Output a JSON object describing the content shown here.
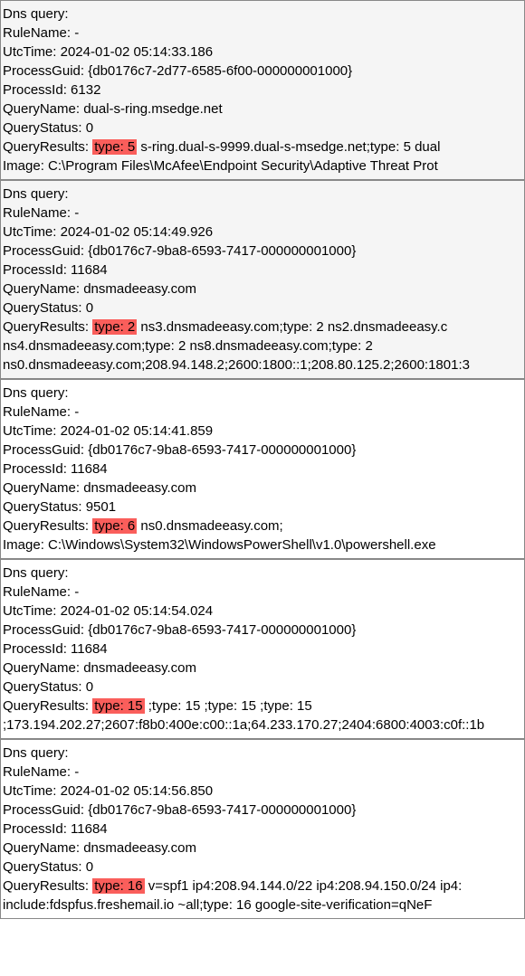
{
  "entries": [
    {
      "alt": true,
      "title": "Dns query:",
      "ruleNameLabel": "RuleName:",
      "ruleName": " -",
      "utcTimeLabel": "UtcTime:",
      "utcTime": " 2024-01-02 05:14:33.186",
      "processGuidLabel": "ProcessGuid:",
      "processGuid": " {db0176c7-2d77-6585-6f00-000000001000}",
      "processIdLabel": "ProcessId:",
      "processId": " 6132",
      "queryNameLabel": "QueryName:",
      "queryName": " dual-s-ring.msedge.net",
      "queryStatusLabel": "QueryStatus:",
      "queryStatus": " 0",
      "queryResultsLabel": "QueryResults:",
      "highlight": "type:  5",
      "queryResultsRest": " s-ring.dual-s-9999.dual-s-msedge.net;type:  5 dual",
      "imageLabel": "Image:",
      "image": " C:\\Program Files\\McAfee\\Endpoint Security\\Adaptive Threat Prot",
      "extraLines": []
    },
    {
      "alt": true,
      "title": "Dns query:",
      "ruleNameLabel": "RuleName:",
      "ruleName": " -",
      "utcTimeLabel": "UtcTime:",
      "utcTime": " 2024-01-02 05:14:49.926",
      "processGuidLabel": "ProcessGuid:",
      "processGuid": " {db0176c7-9ba8-6593-7417-000000001000}",
      "processIdLabel": "ProcessId:",
      "processId": " 11684",
      "queryNameLabel": "QueryName:",
      "queryName": " dnsmadeeasy.com",
      "queryStatusLabel": "QueryStatus:",
      "queryStatus": " 0",
      "queryResultsLabel": "QueryResults:",
      "highlight": "type:  2",
      "queryResultsRest": " ns3.dnsmadeeasy.com;type:  2 ns2.dnsmadeeasy.c",
      "imageLabel": "",
      "image": "",
      "extraLines": [
        "ns4.dnsmadeeasy.com;type:  2 ns8.dnsmadeeasy.com;type:  2 ",
        "ns0.dnsmadeeasy.com;208.94.148.2;2600:1800::1;208.80.125.2;2600:1801:3"
      ]
    },
    {
      "alt": false,
      "title": "Dns query:",
      "ruleNameLabel": "RuleName:",
      "ruleName": " -",
      "utcTimeLabel": "UtcTime:",
      "utcTime": " 2024-01-02 05:14:41.859",
      "processGuidLabel": "ProcessGuid:",
      "processGuid": " {db0176c7-9ba8-6593-7417-000000001000}",
      "processIdLabel": "ProcessId:",
      "processId": " 11684",
      "queryNameLabel": "QueryName:",
      "queryName": " dnsmadeeasy.com",
      "queryStatusLabel": "QueryStatus:",
      "queryStatus": " 9501",
      "queryResultsLabel": "QueryResults:",
      "highlight": "type:  6",
      "queryResultsRest": " ns0.dnsmadeeasy.com;",
      "imageLabel": "Image:",
      "image": " C:\\Windows\\System32\\WindowsPowerShell\\v1.0\\powershell.exe",
      "extraLines": []
    },
    {
      "alt": false,
      "title": "Dns query:",
      "ruleNameLabel": "RuleName:",
      "ruleName": " -",
      "utcTimeLabel": "UtcTime:",
      "utcTime": " 2024-01-02 05:14:54.024",
      "processGuidLabel": "ProcessGuid:",
      "processGuid": " {db0176c7-9ba8-6593-7417-000000001000}",
      "processIdLabel": "ProcessId:",
      "processId": " 11684",
      "queryNameLabel": "QueryName:",
      "queryName": " dnsmadeeasy.com",
      "queryStatusLabel": "QueryStatus:",
      "queryStatus": " 0",
      "queryResultsLabel": "QueryResults:",
      "highlight": "type:  15",
      "queryResultsRest": " ;type:  15 ;type:  15 ;type:  15 ",
      "imageLabel": "",
      "image": "",
      "extraLines": [
        ";173.194.202.27;2607:f8b0:400e:c00::1a;64.233.170.27;2404:6800:4003:c0f::1b"
      ]
    },
    {
      "alt": false,
      "title": "Dns query:",
      "ruleNameLabel": "RuleName:",
      "ruleName": " -",
      "utcTimeLabel": "UtcTime:",
      "utcTime": " 2024-01-02 05:14:56.850",
      "processGuidLabel": "ProcessGuid:",
      "processGuid": " {db0176c7-9ba8-6593-7417-000000001000}",
      "processIdLabel": "ProcessId:",
      "processId": " 11684",
      "queryNameLabel": "QueryName:",
      "queryName": " dnsmadeeasy.com",
      "queryStatusLabel": "QueryStatus:",
      "queryStatus": " 0",
      "queryResultsLabel": "QueryResults:",
      "highlight": "type:  16",
      "queryResultsRest": " v=spf1 ip4:208.94.144.0/22 ip4:208.94.150.0/24 ip4:",
      "imageLabel": "",
      "image": "",
      "extraLines": [
        "include:fdspfus.freshemail.io ~all;type:  16 google-site-verification=qNeF"
      ]
    }
  ]
}
